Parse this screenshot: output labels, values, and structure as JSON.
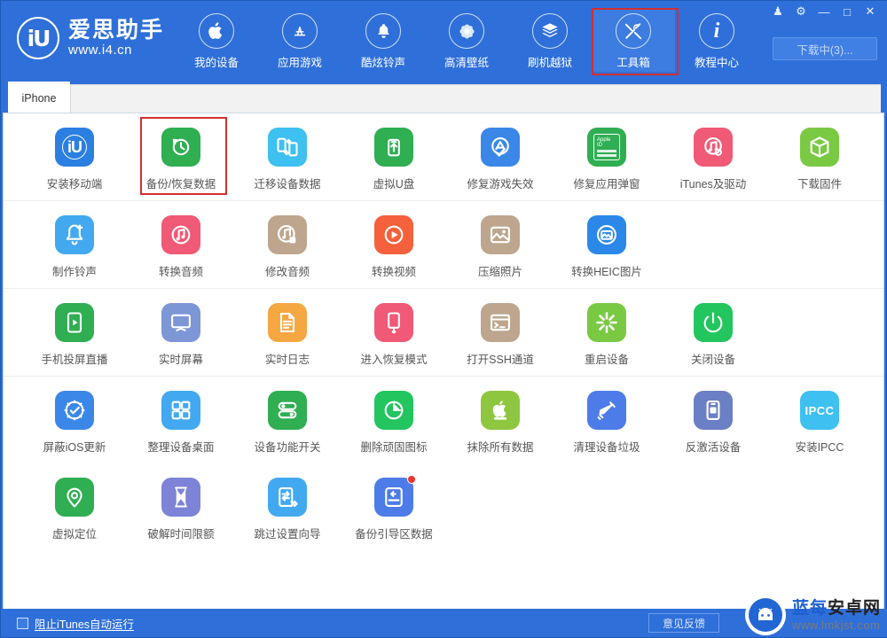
{
  "brand": {
    "logo_mark": "iU",
    "name": "爱思助手",
    "url": "www.i4.cn"
  },
  "topnav": {
    "items": [
      {
        "label": "我的设备",
        "icon": "apple-icon",
        "selected": false
      },
      {
        "label": "应用游戏",
        "icon": "appstore-icon",
        "selected": false
      },
      {
        "label": "酷炫铃声",
        "icon": "bell-icon",
        "selected": false
      },
      {
        "label": "高清壁纸",
        "icon": "flower-icon",
        "selected": false
      },
      {
        "label": "刷机越狱",
        "icon": "flash-icon",
        "selected": false
      },
      {
        "label": "工具箱",
        "icon": "toolbox-icon",
        "selected": true
      },
      {
        "label": "教程中心",
        "icon": "info-icon",
        "selected": false
      }
    ]
  },
  "window_buttons": [
    {
      "name": "skin-icon",
      "glyph": "♟"
    },
    {
      "name": "settings-icon",
      "glyph": "⚙"
    },
    {
      "name": "minimize-icon",
      "glyph": "—"
    },
    {
      "name": "maximize-icon",
      "glyph": "□"
    },
    {
      "name": "close-icon",
      "glyph": "✕"
    }
  ],
  "download_button": {
    "label": "下载中(3)..."
  },
  "tabs": {
    "active": "iPhone",
    "items": [
      "iPhone"
    ]
  },
  "toolbox": {
    "rows": [
      {
        "divider": true,
        "tools": [
          {
            "label": "安装移动端",
            "icon": "i4-app-icon",
            "color": "#2b7fe0",
            "glyph": "iU",
            "highlight": false,
            "badge": false
          },
          {
            "label": "备份/恢复数据",
            "icon": "backup-restore-icon",
            "color": "#2fae52",
            "glyph": "↺",
            "highlight": true,
            "badge": false
          },
          {
            "label": "迁移设备数据",
            "icon": "migrate-device-icon",
            "color": "#3ec0f0",
            "glyph": "⇄",
            "highlight": false,
            "badge": false
          },
          {
            "label": "虚拟U盘",
            "icon": "usb-drive-icon",
            "color": "#2fae52",
            "glyph": "⇅",
            "highlight": false,
            "badge": false
          },
          {
            "label": "修复游戏失效",
            "icon": "fix-game-icon",
            "color": "#3b87e8",
            "glyph": "A✓",
            "highlight": false,
            "badge": false
          },
          {
            "label": "修复应用弹窗",
            "icon": "fix-popup-icon",
            "color": "#2fae52",
            "glyph": "ID",
            "highlight": false,
            "badge": false
          },
          {
            "label": "iTunes及驱动",
            "icon": "itunes-driver-icon",
            "color": "#f05a76",
            "glyph": "♫",
            "highlight": false,
            "badge": false
          },
          {
            "label": "下载固件",
            "icon": "download-firmware-icon",
            "color": "#7ac943",
            "glyph": "◻",
            "highlight": false,
            "badge": false
          }
        ]
      },
      {
        "divider": true,
        "tools": [
          {
            "label": "制作铃声",
            "icon": "make-ringtone-icon",
            "color": "#42a9f0",
            "glyph": "🔔",
            "highlight": false,
            "badge": false
          },
          {
            "label": "转换音频",
            "icon": "convert-audio-icon",
            "color": "#f05a76",
            "glyph": "♪",
            "highlight": false,
            "badge": false
          },
          {
            "label": "修改音频",
            "icon": "edit-audio-icon",
            "color": "#bda68d",
            "glyph": "♪",
            "highlight": false,
            "badge": false
          },
          {
            "label": "转换视频",
            "icon": "convert-video-icon",
            "color": "#f4613c",
            "glyph": "▶",
            "highlight": false,
            "badge": false
          },
          {
            "label": "压缩照片",
            "icon": "compress-photo-icon",
            "color": "#bda68d",
            "glyph": "🖼",
            "highlight": false,
            "badge": false
          },
          {
            "label": "转换HEIC图片",
            "icon": "convert-heic-icon",
            "color": "#2b88e8",
            "glyph": "🖼",
            "highlight": false,
            "badge": false
          }
        ]
      },
      {
        "divider": true,
        "tools": [
          {
            "label": "手机投屏直播",
            "icon": "screen-cast-icon",
            "color": "#2fae52",
            "glyph": "▶",
            "highlight": false,
            "badge": false
          },
          {
            "label": "实时屏幕",
            "icon": "live-screen-icon",
            "color": "#7d96d6",
            "glyph": "🖵",
            "highlight": false,
            "badge": false
          },
          {
            "label": "实时日志",
            "icon": "live-log-icon",
            "color": "#f5a742",
            "glyph": "📄",
            "highlight": false,
            "badge": false
          },
          {
            "label": "进入恢复模式",
            "icon": "recovery-mode-icon",
            "color": "#f05a76",
            "glyph": "▭",
            "highlight": false,
            "badge": false
          },
          {
            "label": "打开SSH通道",
            "icon": "ssh-tunnel-icon",
            "color": "#bda68d",
            "glyph": ">_",
            "highlight": false,
            "badge": false
          },
          {
            "label": "重启设备",
            "icon": "reboot-device-icon",
            "color": "#7ac943",
            "glyph": "✳",
            "highlight": false,
            "badge": false
          },
          {
            "label": "关闭设备",
            "icon": "shutdown-device-icon",
            "color": "#22c55e",
            "glyph": "⏻",
            "highlight": false,
            "badge": false
          }
        ]
      },
      {
        "divider": false,
        "tools": [
          {
            "label": "屏蔽iOS更新",
            "icon": "block-ios-update-icon",
            "color": "#3b87e8",
            "glyph": "⚙",
            "highlight": false,
            "badge": false
          },
          {
            "label": "整理设备桌面",
            "icon": "organize-desktop-icon",
            "color": "#42a9f0",
            "glyph": "▦",
            "highlight": false,
            "badge": false
          },
          {
            "label": "设备功能开关",
            "icon": "feature-toggle-icon",
            "color": "#2fae52",
            "glyph": "⚌",
            "highlight": false,
            "badge": false
          },
          {
            "label": "删除顽固图标",
            "icon": "delete-icon-icon",
            "color": "#22c55e",
            "glyph": "◕",
            "highlight": false,
            "badge": false
          },
          {
            "label": "抹除所有数据",
            "icon": "erase-all-data-icon",
            "color": "#8ec63f",
            "glyph": "",
            "highlight": false,
            "badge": false
          },
          {
            "label": "清理设备垃圾",
            "icon": "clean-junk-icon",
            "color": "#4d7ce8",
            "glyph": "🧹",
            "highlight": false,
            "badge": false
          },
          {
            "label": "反激活设备",
            "icon": "deactivate-device-icon",
            "color": "#6b7fc4",
            "glyph": "▭",
            "highlight": false,
            "badge": false
          },
          {
            "label": "安装IPCC",
            "icon": "install-ipcc-icon",
            "color": "#3ec0f0",
            "glyph": "IPCC",
            "highlight": false,
            "badge": false
          }
        ]
      },
      {
        "divider": false,
        "tools": [
          {
            "label": "虚拟定位",
            "icon": "virtual-location-icon",
            "color": "#2fae52",
            "glyph": "◎",
            "highlight": false,
            "badge": false
          },
          {
            "label": "破解时间限额",
            "icon": "crack-time-limit-icon",
            "color": "#7d83d6",
            "glyph": "⧗",
            "highlight": false,
            "badge": false
          },
          {
            "label": "跳过设置向导",
            "icon": "skip-setup-icon",
            "color": "#42a9f0",
            "glyph": "⇥",
            "highlight": false,
            "badge": false
          },
          {
            "label": "备份引导区数据",
            "icon": "backup-boot-data-icon",
            "color": "#4d7ce8",
            "glyph": "↩",
            "highlight": false,
            "badge": true
          }
        ]
      }
    ]
  },
  "statusbar": {
    "checkbox_label": "阻止iTunes自动运行",
    "checkbox_checked": false,
    "feedback_label": "意见反馈"
  },
  "watermark": {
    "title_left": "蓝每",
    "title_right": "安卓网",
    "url": "www.lmkjst.com"
  },
  "colors": {
    "brand_blue": "#2f6fd9",
    "highlight_red": "#d32f2f",
    "content_bg": "#ffffff"
  }
}
